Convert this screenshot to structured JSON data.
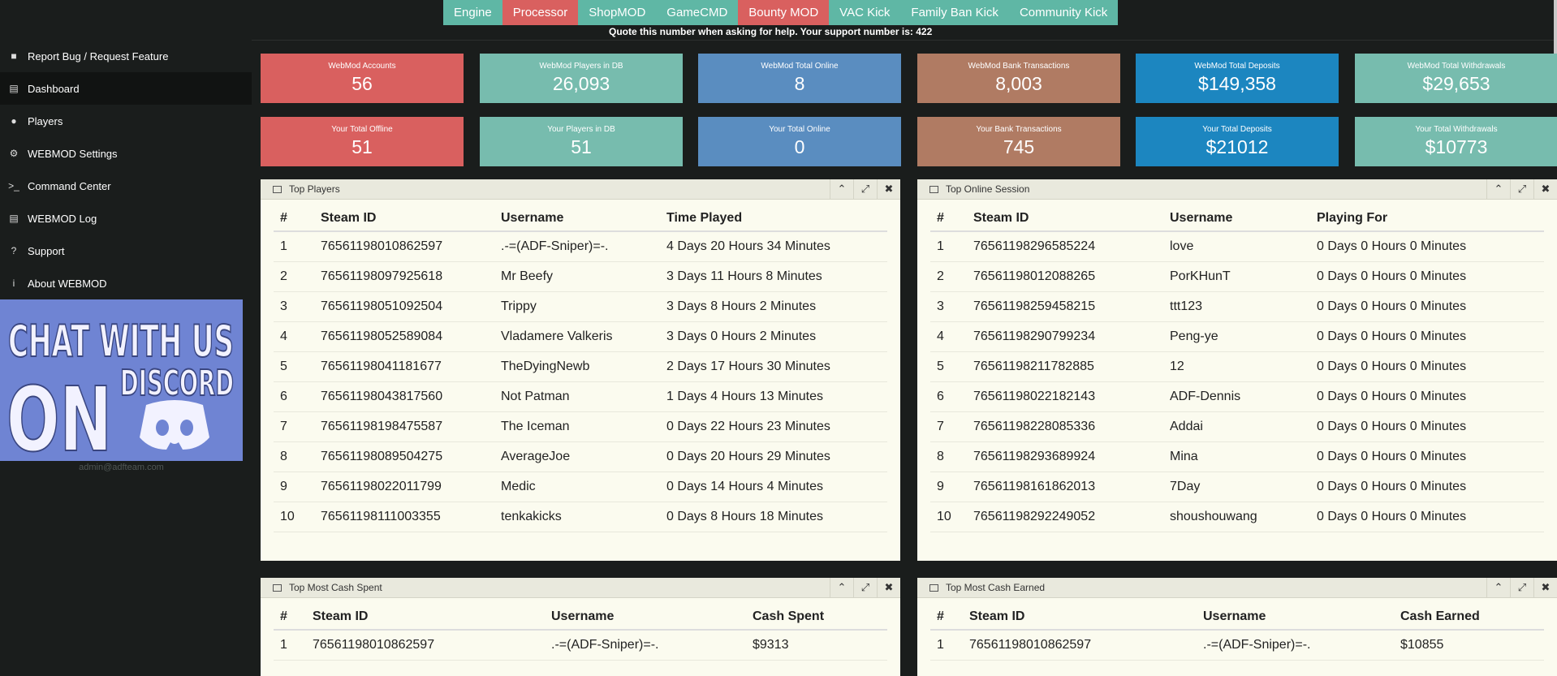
{
  "topnav": [
    {
      "label": "Engine",
      "color": "#5fb7a5"
    },
    {
      "label": "Processor",
      "color": "#d9605f"
    },
    {
      "label": "ShopMOD",
      "color": "#5fb7a5"
    },
    {
      "label": "GameCMD",
      "color": "#5fb7a5"
    },
    {
      "label": "Bounty MOD",
      "color": "#d9605f"
    },
    {
      "label": "VAC Kick",
      "color": "#5fb7a5"
    },
    {
      "label": "Family Ban Kick",
      "color": "#5fb7a5"
    },
    {
      "label": "Community Kick",
      "color": "#5fb7a5"
    }
  ],
  "support_message": "Quote this number when asking for help. Your support number is: 422",
  "sidebar": {
    "items": [
      {
        "label": "Report Bug / Request Feature",
        "icon": "bug-icon"
      },
      {
        "label": "Dashboard",
        "icon": "dashboard-icon"
      },
      {
        "label": "Players",
        "icon": "users-icon"
      },
      {
        "label": "WEBMOD Settings",
        "icon": "gear-icon"
      },
      {
        "label": "Command Center",
        "icon": "terminal-icon"
      },
      {
        "label": "WEBMOD Log",
        "icon": "list-icon"
      },
      {
        "label": "Support",
        "icon": "question-icon"
      },
      {
        "label": "About WEBMOD",
        "icon": "info-icon"
      }
    ],
    "banner_text": "CHAT WITH US ON DISCORD",
    "footer_email": "admin@adfteam.com"
  },
  "stats_row1": [
    {
      "label": "WebMod Accounts",
      "value": "56",
      "color": "#d9605f"
    },
    {
      "label": "WebMod Players in DB",
      "value": "26,093",
      "color": "#77bcae"
    },
    {
      "label": "WebMod Total Online",
      "value": "8",
      "color": "#5a8dc0"
    },
    {
      "label": "WebMod Bank Transactions",
      "value": "8,003",
      "color": "#b07b63"
    },
    {
      "label": "WebMod Total Deposits",
      "value": "$149,358",
      "color": "#1c86c0"
    },
    {
      "label": "WebMod Total Withdrawals",
      "value": "$29,653",
      "color": "#77bcae"
    }
  ],
  "stats_row2": [
    {
      "label": "Your Total Offline",
      "value": "51",
      "color": "#d9605f"
    },
    {
      "label": "Your Players in DB",
      "value": "51",
      "color": "#77bcae"
    },
    {
      "label": "Your Total Online",
      "value": "0",
      "color": "#5a8dc0"
    },
    {
      "label": "Your Bank Transactions",
      "value": "745",
      "color": "#b07b63"
    },
    {
      "label": "Your Total Deposits",
      "value": "$21012",
      "color": "#1c86c0"
    },
    {
      "label": "Your Total Withdrawals",
      "value": "$10773",
      "color": "#77bcae"
    }
  ],
  "top_players": {
    "title": "Top Players",
    "headers": [
      "#",
      "Steam ID",
      "Username",
      "Time Played"
    ],
    "rows": [
      [
        "1",
        "76561198010862597",
        ".-=(ADF-Sniper)=-.",
        "4 Days 20 Hours 34 Minutes"
      ],
      [
        "2",
        "76561198097925618",
        "Mr Beefy",
        "3 Days 11 Hours 8 Minutes"
      ],
      [
        "3",
        "76561198051092504",
        "Trippy",
        "3 Days 8 Hours 2 Minutes"
      ],
      [
        "4",
        "76561198052589084",
        "Vladamere Valkeris",
        "3 Days 0 Hours 2 Minutes"
      ],
      [
        "5",
        "76561198041181677",
        "TheDyingNewb",
        "2 Days 17 Hours 30 Minutes"
      ],
      [
        "6",
        "76561198043817560",
        "Not Patman",
        "1 Days 4 Hours 13 Minutes"
      ],
      [
        "7",
        "76561198198475587",
        "The Iceman",
        "0 Days 22 Hours 23 Minutes"
      ],
      [
        "8",
        "76561198089504275",
        "AverageJoe",
        "0 Days 20 Hours 29 Minutes"
      ],
      [
        "9",
        "76561198022011799",
        "Medic",
        "0 Days 14 Hours 4 Minutes"
      ],
      [
        "10",
        "76561198111003355",
        "tenkakicks",
        "0 Days 8 Hours 18 Minutes"
      ]
    ]
  },
  "top_online": {
    "title": "Top Online Session",
    "headers": [
      "#",
      "Steam ID",
      "Username",
      "Playing For"
    ],
    "rows": [
      [
        "1",
        "76561198296585224",
        "love",
        "0 Days 0 Hours 0 Minutes"
      ],
      [
        "2",
        "76561198012088265",
        "PorKHunT",
        "0 Days 0 Hours 0 Minutes"
      ],
      [
        "3",
        "76561198259458215",
        "ttt123",
        "0 Days 0 Hours 0 Minutes"
      ],
      [
        "4",
        "76561198290799234",
        "Peng-ye",
        "0 Days 0 Hours 0 Minutes"
      ],
      [
        "5",
        "76561198211782885",
        "12",
        "0 Days 0 Hours 0 Minutes"
      ],
      [
        "6",
        "76561198022182143",
        "ADF-Dennis",
        "0 Days 0 Hours 0 Minutes"
      ],
      [
        "7",
        "76561198228085336",
        "Addai",
        "0 Days 0 Hours 0 Minutes"
      ],
      [
        "8",
        "76561198293689924",
        "Mina",
        "0 Days 0 Hours 0 Minutes"
      ],
      [
        "9",
        "76561198161862013",
        "7Day",
        "0 Days 0 Hours 0 Minutes"
      ],
      [
        "10",
        "76561198292249052",
        "shoushouwang",
        "0 Days 0 Hours 0 Minutes"
      ]
    ]
  },
  "top_spent": {
    "title": "Top Most Cash Spent",
    "headers": [
      "#",
      "Steam ID",
      "Username",
      "Cash Spent"
    ],
    "rows": [
      [
        "1",
        "76561198010862597",
        ".-=(ADF-Sniper)=-.",
        "$9313"
      ]
    ]
  },
  "top_earned": {
    "title": "Top Most Cash Earned",
    "headers": [
      "#",
      "Steam ID",
      "Username",
      "Cash Earned"
    ],
    "rows": [
      [
        "1",
        "76561198010862597",
        ".-=(ADF-Sniper)=-.",
        "$10855"
      ]
    ]
  }
}
